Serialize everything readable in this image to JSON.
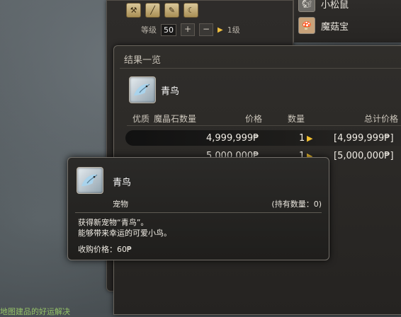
{
  "crafting": {
    "tools": [
      "hammer-icon",
      "knife-icon",
      "chisel-icon",
      "sickle-icon"
    ],
    "level_label": "等级",
    "level_value": "50",
    "plus": "+",
    "minus": "−",
    "level_target": "1级"
  },
  "list": {
    "items": [
      {
        "label": "小松鼠",
        "icon": "squirrel-icon"
      },
      {
        "label": "魔菇宝",
        "icon": "mushroom-icon"
      }
    ]
  },
  "results": {
    "title": "结果一览",
    "item_name": "青鸟",
    "columns": {
      "quality": "优质",
      "materia": "魔晶石数量",
      "price": "价格",
      "qty": "数量",
      "total": "总计价格"
    },
    "rows": [
      {
        "price": "4,999,999₱",
        "qty": "1",
        "total": "[4,999,999₱]"
      },
      {
        "price": "5,000,000₱",
        "qty": "1",
        "total": "[5,000,000₱]"
      }
    ]
  },
  "tooltip": {
    "name": "青鸟",
    "category": "宠物",
    "owned": "(持有数量：0)",
    "desc_line1": "获得新宠物“青鸟”。",
    "desc_line2": "能够带来幸运的可爱小鸟。",
    "price": "收购价格：60₱"
  },
  "bottom_hint": "地图建品的好运解决"
}
